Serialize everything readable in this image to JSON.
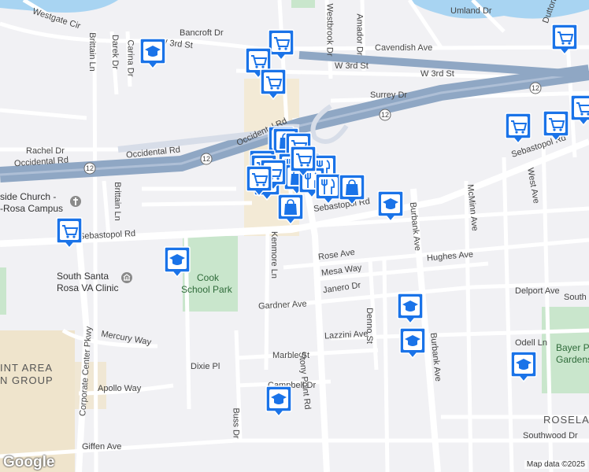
{
  "labels": {
    "westgate": "Westgate Cir",
    "bancroft": "Bancroft Dr",
    "w3rd_a": "W 3rd St",
    "w3rd_b": "W 3rd St",
    "w3rd_c": "W 3rd St",
    "brittain_n": "Brittain Ln",
    "brittain_s": "Brittain Ln",
    "darek": "Darek Dr",
    "carina": "Carina Dr",
    "westbrook": "Westbrook Dr",
    "amador": "Amador Dr",
    "cavendish": "Cavendish Ave",
    "umland": "Umland Dr",
    "dutton": "Dutton",
    "surrey": "Surrey Dr",
    "occidental_rd_a": "Occidental Rd",
    "occidental_rd_b": "Occidental Rd",
    "occidental_rd_c": "Occidental Rd",
    "rachel": "Rachel Dr",
    "church1": "side Church -",
    "church2": "-Rosa Campus",
    "sebastopol_w": "Sebastopol Rd",
    "sebastopol_mid": "Sebastopol Rd",
    "sebastopol_e": "Sebastopol Rd",
    "kenmore": "Kenmore Ln",
    "burbank_n": "Burbank Ave",
    "burbank_s": "Burbank Ave",
    "mcminn": "McMinn Ave",
    "west_ave": "West Ave",
    "rose": "Rose Ave",
    "mesa": "Mesa Way",
    "hughes": "Hughes Ave",
    "janero": "Janero Dr",
    "delport": "Delport Ave",
    "south_e": "South",
    "va1": "South Santa",
    "va2": "Rosa VA Clinic",
    "cook1": "Cook",
    "cook2": "School Park",
    "gardner": "Gardner Ave",
    "lazzini": "Lazzini Ave",
    "denno": "Denno St",
    "mercury": "Mercury Way",
    "corporate": "Corporate Center Pkwy",
    "area1": "INT AREA",
    "area2": "N GROUP",
    "dixie": "Dixie Pl",
    "marble": "Marble St",
    "stony": "Stony Point Rd",
    "odell": "Odell Ln",
    "bayer1": "Bayer Park",
    "bayer2": "Gardens",
    "apollo": "Apollo Way",
    "campbell": "Campbell Dr",
    "buss": "Buss Dr",
    "roseland": "ROSELAN",
    "southwood": "Southwood Dr",
    "giffen": "Giffen Ave",
    "hwy12_a": "12",
    "hwy12_b": "12",
    "hwy12_c": "12",
    "hwy12_d": "12"
  },
  "attribution": {
    "logo": "Google",
    "map_data": "Map data ©2025"
  },
  "colors": {
    "pin_fill": "#1a73e8",
    "highway": "#8fa7c4",
    "park": "#c9e6cc",
    "water": "#a8d4f2"
  },
  "markers": [
    {
      "icon": "school-icon"
    },
    {
      "icon": "shopping-cart-icon"
    },
    {
      "icon": "shopping-cart-icon"
    },
    {
      "icon": "shopping-cart-icon"
    },
    {
      "icon": "shopping-cart-icon"
    },
    {
      "icon": "shopping-cart-icon"
    },
    {
      "icon": "shopping-cart-icon"
    },
    {
      "icon": "shopping-cart-icon"
    },
    {
      "icon": "shopping-cart-icon"
    },
    {
      "icon": "shopping-bag-icon"
    },
    {
      "icon": "shopping-cart-icon"
    },
    {
      "icon": "shopping-cart-icon"
    },
    {
      "icon": "restaurant-icon"
    },
    {
      "icon": "restaurant-icon"
    },
    {
      "icon": "restaurant-icon"
    },
    {
      "icon": "shopping-bag-icon"
    },
    {
      "icon": "restaurant-icon"
    },
    {
      "icon": "restaurant-icon"
    },
    {
      "icon": "shopping-bag-icon"
    },
    {
      "icon": "school-icon"
    },
    {
      "icon": "shopping-bag-icon"
    },
    {
      "icon": "shopping-cart-icon"
    },
    {
      "icon": "school-icon"
    },
    {
      "icon": "school-icon"
    },
    {
      "icon": "school-icon"
    },
    {
      "icon": "school-icon"
    },
    {
      "icon": "school-icon"
    },
    {
      "icon": "shopping-cart-icon"
    },
    {
      "icon": "shopping-cart-icon"
    },
    {
      "icon": "shopping-cart-icon"
    },
    {
      "icon": "shopping-cart-icon"
    },
    {
      "icon": "shopping-cart-icon"
    }
  ]
}
